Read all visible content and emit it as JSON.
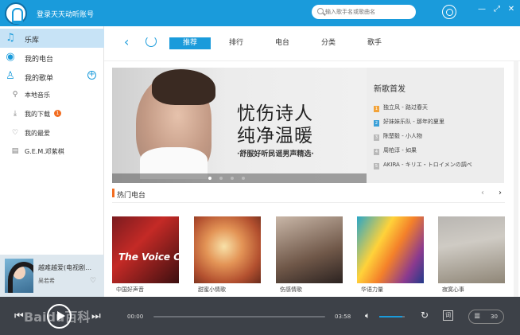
{
  "titlebar": {
    "login_text": "登录天天动听账号",
    "search_placeholder": "输入歌手名或歌曲名",
    "minimize": "—",
    "restore": "⤢",
    "close": "✕"
  },
  "sidebar": {
    "items": [
      {
        "label": "乐库",
        "icon": "music-note-icon"
      },
      {
        "label": "我的电台",
        "icon": "radio-icon"
      },
      {
        "label": "我的歌单",
        "icon": "user-list-icon"
      },
      {
        "label": "本地音乐",
        "icon": "pin-icon"
      },
      {
        "label": "我的下载",
        "icon": "download-icon",
        "badge": "1"
      },
      {
        "label": "我的最爱",
        "icon": "heart-icon"
      },
      {
        "label": "G.E.M.邓紫棋",
        "icon": "document-icon"
      }
    ]
  },
  "now_playing": {
    "title": "越难越爱(电视剧…",
    "artist": "吴若希"
  },
  "nav": {
    "tabs": [
      {
        "label": "推荐"
      },
      {
        "label": "排行"
      },
      {
        "label": "电台"
      },
      {
        "label": "分类"
      },
      {
        "label": "歌手"
      }
    ]
  },
  "banner": {
    "line1": "忧伤诗人",
    "line2": "纯净温暖",
    "subtitle": "·舒服好听民谣男声精选·"
  },
  "new_songs": {
    "heading": "新歌首发",
    "items": [
      {
        "num": "1",
        "text": "独立风 - 路过春天",
        "color": "#f2a33a"
      },
      {
        "num": "2",
        "text": "好妹妹乐队 - 那年的夏里",
        "color": "#3aa0d8"
      },
      {
        "num": "3",
        "text": "陈楚毅 - 小人物",
        "color": "#b9b9b9"
      },
      {
        "num": "4",
        "text": "周柏淳 - 如果",
        "color": "#b9b9b9"
      },
      {
        "num": "5",
        "text": "AKIRA - キリエ・トロイメンの調べ",
        "color": "#b9b9b9"
      }
    ]
  },
  "hot_radio": {
    "title": "热门电台",
    "cards": [
      {
        "label": "中国好声音",
        "cover_text": "The Voice China"
      },
      {
        "label": "甜蜜小情歌"
      },
      {
        "label": "伤感情歌"
      },
      {
        "label": "华语力量"
      },
      {
        "label": "寂寞心事"
      }
    ]
  },
  "player": {
    "current_time": "00:00",
    "total_time": "03:58",
    "progress": 0.0,
    "volume": 0.9,
    "lyrics_label": "词",
    "playlist_count": "30",
    "watermark": "Baidu百科"
  }
}
